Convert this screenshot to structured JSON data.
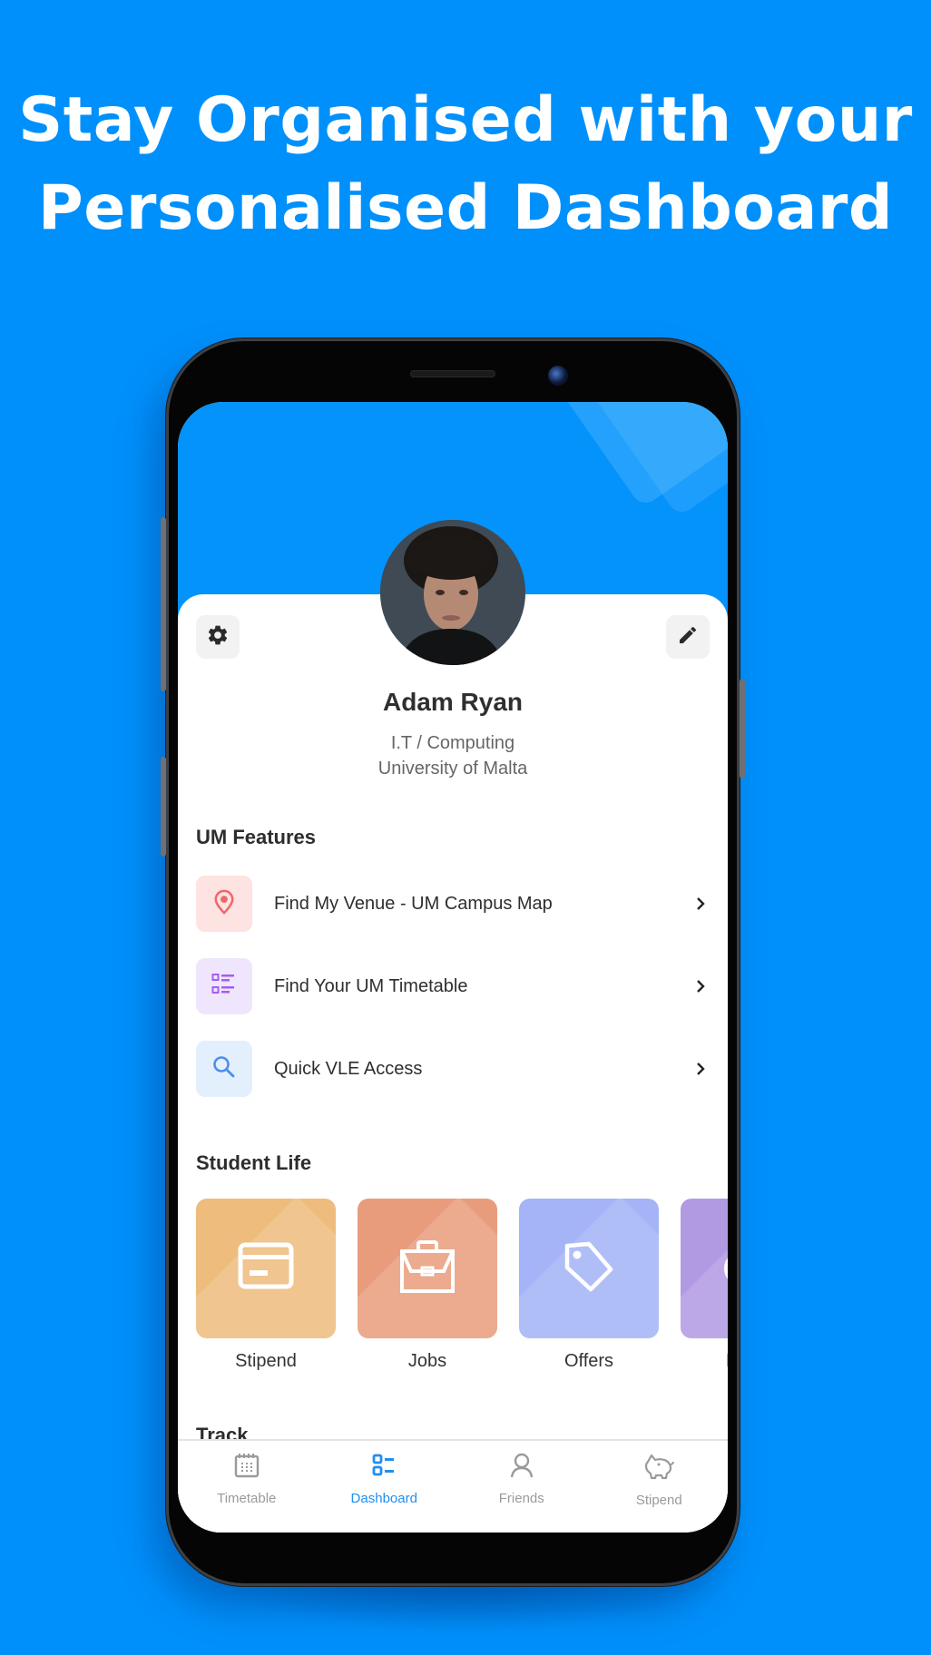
{
  "headline": {
    "line1": "Stay Organised with your",
    "line2": "Personalised Dashboard"
  },
  "colors": {
    "background": "#0090fb",
    "header": "#0492fb",
    "accent": "#1f8ff0",
    "tab_inactive": "#9a9a9a"
  },
  "profile": {
    "avatar_icon": "avatar-photo",
    "name": "Adam Ryan",
    "course": "I.T / Computing",
    "university": "University of Malta",
    "settings_icon": "gear-icon",
    "edit_icon": "pencil-icon"
  },
  "um_features": {
    "title": "UM Features",
    "items": [
      {
        "label": "Find My Venue - UM Campus Map",
        "icon": "map-pin-icon",
        "bg": "#fde3e1",
        "fg": "#f0676a"
      },
      {
        "label": "Find Your UM Timetable",
        "icon": "list-icon",
        "bg": "#efe6fd",
        "fg": "#a45ef0"
      },
      {
        "label": "Quick VLE Access",
        "icon": "search-icon",
        "bg": "#e4effd",
        "fg": "#4b8fe8"
      }
    ]
  },
  "student_life": {
    "title": "Student Life",
    "tiles": [
      {
        "label": "Stipend",
        "icon": "credit-card-icon",
        "color": "#eebc7d"
      },
      {
        "label": "Jobs",
        "icon": "briefcase-icon",
        "color": "#e99c7c"
      },
      {
        "label": "Offers",
        "icon": "tag-icon",
        "color": "#a4b4f7"
      },
      {
        "label": "E",
        "icon": "partial-icon",
        "color": "#b29ae3"
      }
    ]
  },
  "track": {
    "title": "Track"
  },
  "tabbar": {
    "tabs": [
      {
        "label": "Timetable",
        "icon": "calendar-icon",
        "active": false
      },
      {
        "label": "Dashboard",
        "icon": "dashboard-icon",
        "active": true
      },
      {
        "label": "Friends",
        "icon": "person-icon",
        "active": false
      },
      {
        "label": "Stipend",
        "icon": "piggy-bank-icon",
        "active": false
      }
    ]
  }
}
